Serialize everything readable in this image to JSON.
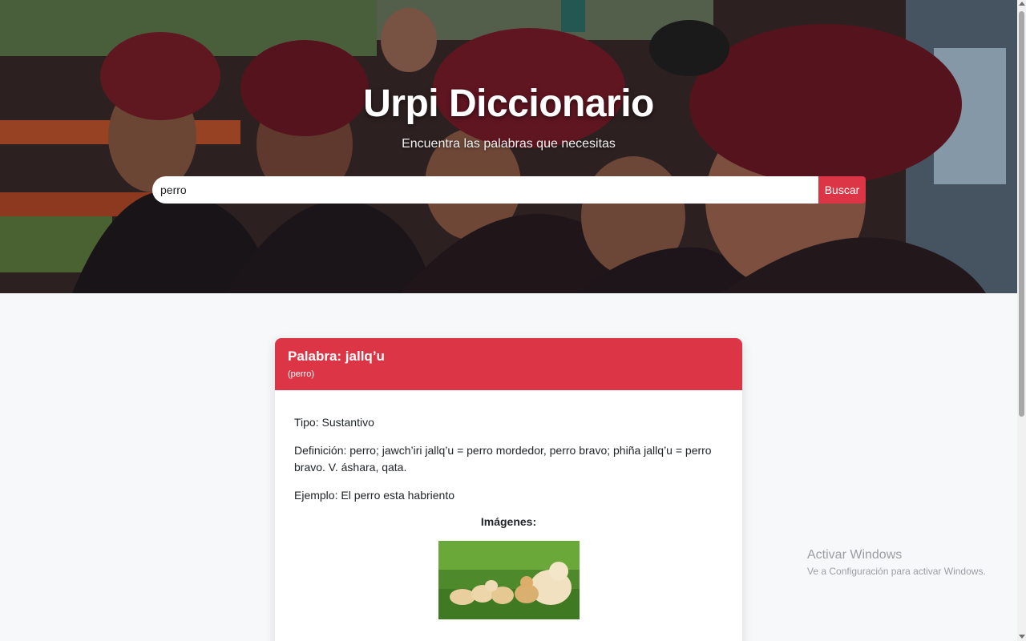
{
  "hero": {
    "title": "Urpi Diccionario",
    "subtitle": "Encuentra las palabras que necesitas",
    "accent": "#dc3545"
  },
  "search": {
    "value": "perro",
    "button_label": "Buscar"
  },
  "result": {
    "title": "Palabra: jallq’u",
    "translation": "(perro)",
    "type": "Tipo: Sustantivo",
    "definition": "Definición: perro; jawch’iri jallq’u = perro mordedor, perro bravo; phiña jallq’u = perro bravo. V. áshara, qata.",
    "example": "Ejemplo: El perro esta habriento",
    "images_heading": "Imágenes:"
  },
  "watermark": {
    "title": "Activar Windows",
    "subtitle": "Ve a Configuración para activar Windows."
  }
}
